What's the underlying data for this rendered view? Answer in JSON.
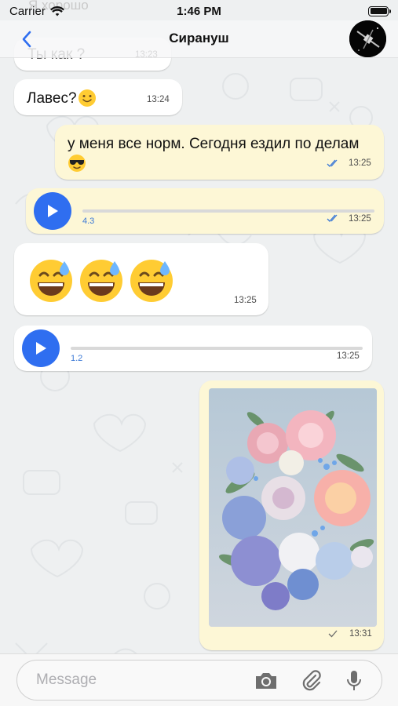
{
  "status_bar": {
    "carrier": "Carrier",
    "time": "1:46 PM"
  },
  "header": {
    "title": "Сирануш",
    "partial_top_text": "Я хорошо"
  },
  "messages": [
    {
      "direction": "in",
      "text": "Ты как ?",
      "time": "13:23"
    },
    {
      "direction": "in",
      "text": "Лавес?",
      "emoji": "slightly-smiling-face",
      "time": "13:24"
    },
    {
      "direction": "out",
      "text": "у меня все норм. Сегодня ездил по делам",
      "emoji": "smiling-face-with-sunglasses",
      "time": "13:25",
      "read": true
    },
    {
      "direction": "out",
      "type": "voice",
      "duration": "4.3",
      "time": "13:25",
      "read": true
    },
    {
      "direction": "in",
      "type": "emoji",
      "emojis": [
        "grinning-face-with-sweat",
        "grinning-face-with-sweat",
        "grinning-face-with-sweat"
      ],
      "time": "13:25"
    },
    {
      "direction": "in",
      "type": "voice",
      "duration": "1.2",
      "time": "13:25"
    },
    {
      "direction": "out",
      "type": "image",
      "image": "flower-bouquet",
      "time": "13:31",
      "read": false
    }
  ],
  "input": {
    "placeholder": "Message"
  },
  "icons": {
    "back": "chevron-left-icon",
    "camera": "camera-icon",
    "attach": "paperclip-icon",
    "mic": "microphone-icon"
  },
  "colors": {
    "accent": "#2f6ef0",
    "outgoing_bubble": "#fdf7d6",
    "incoming_bubble": "#ffffff"
  }
}
